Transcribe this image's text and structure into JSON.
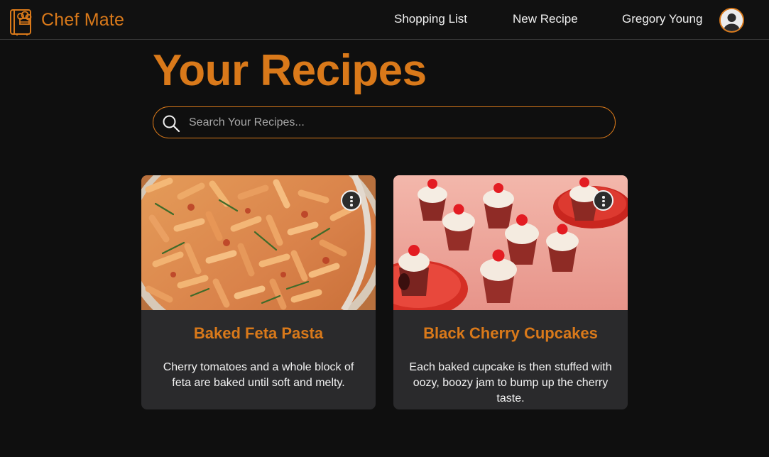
{
  "app": {
    "name": "Chef Mate",
    "logo_icon": "chef-book-icon",
    "accent_color": "#d9791a",
    "background_color": "#0f0f0f"
  },
  "nav": {
    "shopping_list": "Shopping List",
    "new_recipe": "New Recipe",
    "user_name": "Gregory Young",
    "avatar_icon": "user-avatar-icon"
  },
  "page": {
    "title": "Your Recipes"
  },
  "search": {
    "placeholder": "Search Your Recipes...",
    "value": "",
    "icon": "search-icon"
  },
  "recipes": [
    {
      "title": "Baked Feta Pasta",
      "description": "Cherry tomatoes and a whole block of feta are baked until soft and melty.",
      "menu_icon": "more-vertical-icon"
    },
    {
      "title": "Black Cherry Cupcakes",
      "description": "Each baked cupcake is then stuffed with oozy, boozy jam to bump up the cherry taste.",
      "menu_icon": "more-vertical-icon"
    }
  ]
}
